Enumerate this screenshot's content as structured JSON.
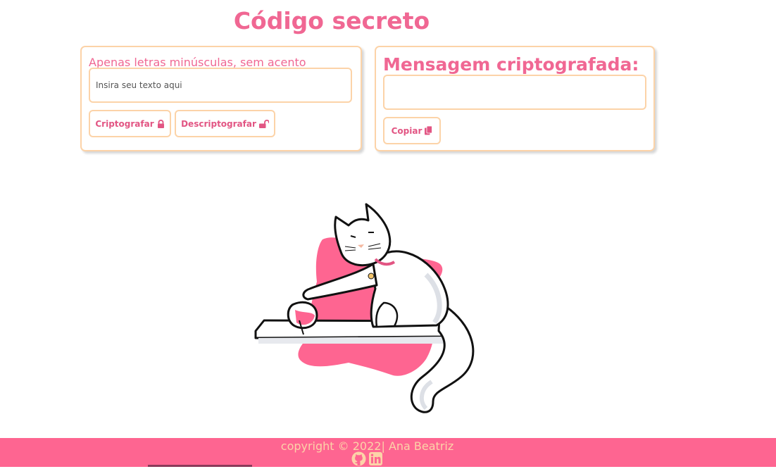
{
  "page": {
    "title": "Código secreto"
  },
  "encrypt_panel": {
    "instruction": "Apenas letras minúsculas, sem acento",
    "input_placeholder": "Insira seu texto aqui",
    "encrypt_label": "Criptografar",
    "decrypt_label": "Descriptografar",
    "encrypt_icon": "lock-icon",
    "decrypt_icon": "unlock-icon"
  },
  "result_panel": {
    "heading": "Mensagem criptografada:",
    "output_value": "",
    "copy_label": "Copiar",
    "copy_icon": "copy-icon"
  },
  "illustration": {
    "name": "cat-on-shelf-illustration"
  },
  "footer": {
    "copyright": "copyright © 2022| Ana Beatriz",
    "icons": [
      "github-icon",
      "linkedin-icon"
    ]
  },
  "colors": {
    "accent": "#f06793",
    "border": "#fcd3a8",
    "footer_bg": "#fe6591"
  }
}
